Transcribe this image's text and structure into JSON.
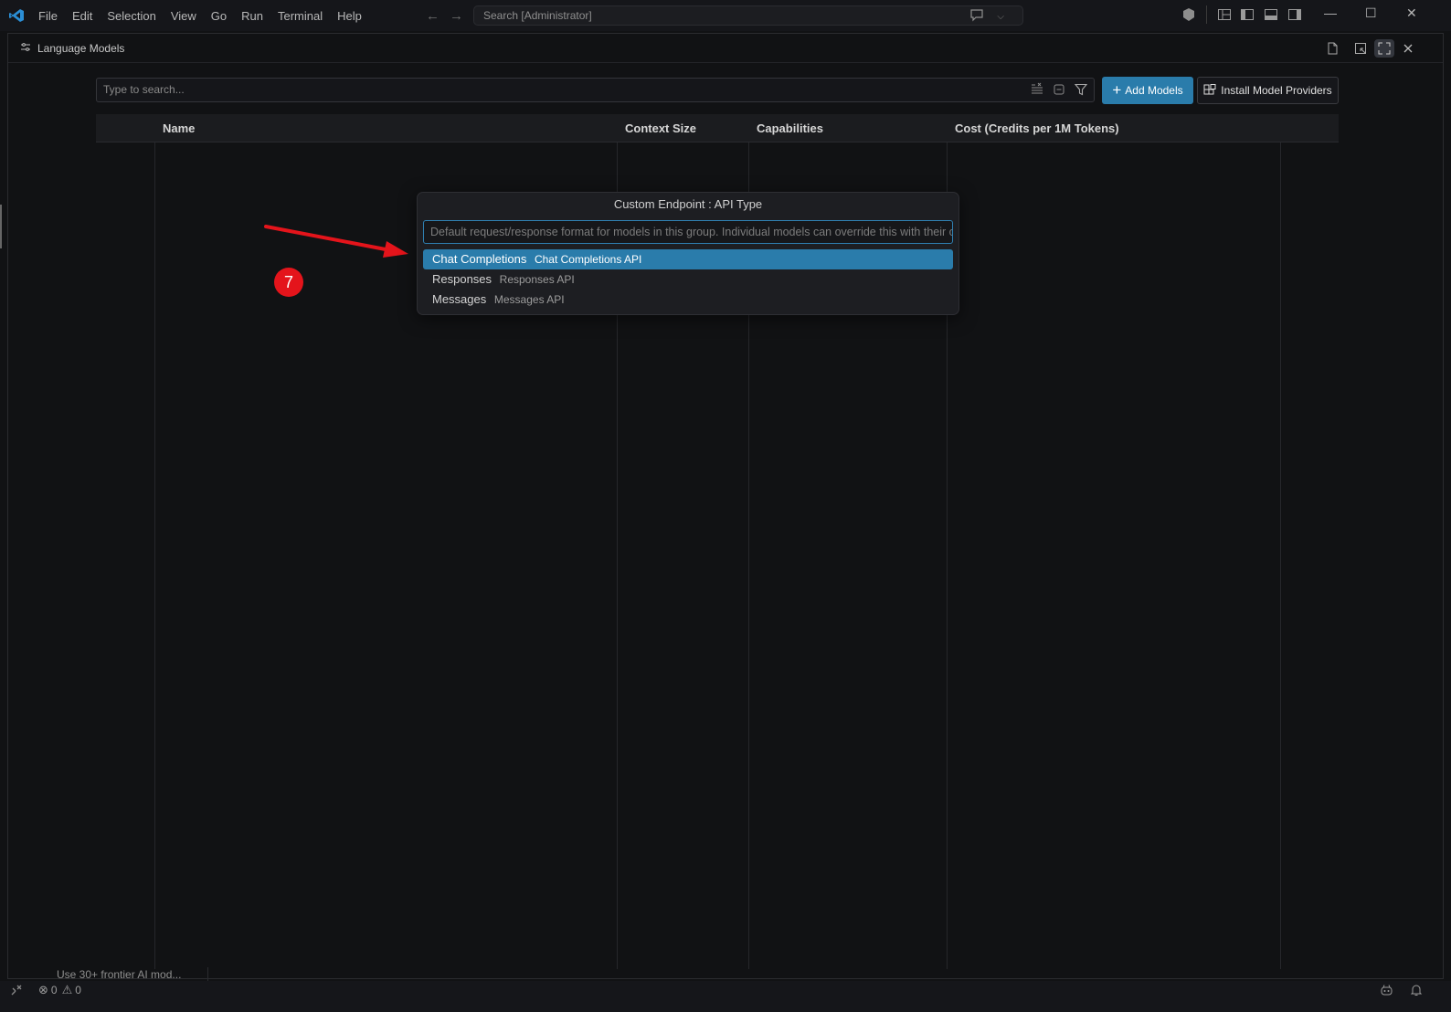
{
  "menu": {
    "items": [
      "File",
      "Edit",
      "Selection",
      "View",
      "Go",
      "Run",
      "Terminal",
      "Help"
    ]
  },
  "command_center": {
    "text": "Search [Administrator]"
  },
  "editor": {
    "title": "Language Models"
  },
  "search": {
    "placeholder": "Type to search..."
  },
  "buttons": {
    "add_models": "Add Models",
    "install_providers": "Install Model Providers"
  },
  "table": {
    "headers": [
      "Name",
      "Context Size",
      "Capabilities",
      "Cost (Credits per 1M Tokens)"
    ]
  },
  "quick_pick": {
    "title": "Custom Endpoint : API Type",
    "input_placeholder": "Default request/response format for models in this group. Individual models can override this with their own setting.",
    "items": [
      {
        "label": "Chat Completions",
        "description": "Chat Completions API",
        "selected": true
      },
      {
        "label": "Responses",
        "description": "Responses API",
        "selected": false
      },
      {
        "label": "Messages",
        "description": "Messages API",
        "selected": false
      }
    ]
  },
  "annotation": {
    "step_number": "7",
    "color": "#e4141b"
  },
  "background_panel": {
    "text": "Use 30+ frontier AI mod..."
  },
  "status": {
    "errors": "0",
    "warnings": "0"
  },
  "colors": {
    "accent": "#2a7cab"
  }
}
